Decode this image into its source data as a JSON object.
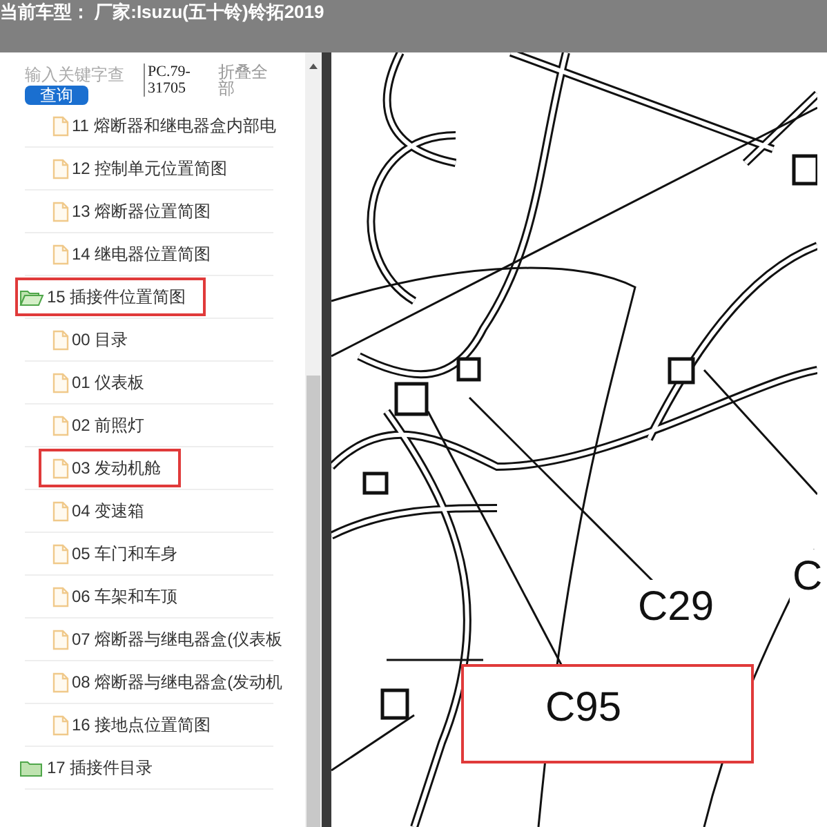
{
  "header": {
    "title": "当前车型： 厂家:Isuzu(五十铃)铃拓2019"
  },
  "search": {
    "placeholder": "输入关键字查",
    "button": "查询",
    "code": "PC.79-31705",
    "collapse": "折叠全部"
  },
  "tree": {
    "continued_children": [
      {
        "label": "11 熔断器和继电器盒内部电",
        "kind": "file",
        "highlighted": false
      },
      {
        "label": "12 控制单元位置简图",
        "kind": "file",
        "highlighted": false
      },
      {
        "label": "13 熔断器位置简图",
        "kind": "file",
        "highlighted": false
      },
      {
        "label": "14 继电器位置简图",
        "kind": "file",
        "highlighted": false
      }
    ],
    "items": [
      {
        "label": "15 插接件位置简图",
        "kind": "folder",
        "expanded": true,
        "highlighted": true,
        "children": [
          {
            "label": "00 目录",
            "kind": "file",
            "highlighted": false
          },
          {
            "label": "01 仪表板",
            "kind": "file",
            "highlighted": false
          },
          {
            "label": "02 前照灯",
            "kind": "file",
            "highlighted": false
          },
          {
            "label": "03 发动机舱",
            "kind": "file",
            "highlighted": true
          },
          {
            "label": "04 变速箱",
            "kind": "file",
            "highlighted": false
          },
          {
            "label": "05 车门和车身",
            "kind": "file",
            "highlighted": false
          },
          {
            "label": "06 车架和车顶",
            "kind": "file",
            "highlighted": false
          },
          {
            "label": "07 熔断器与继电器盒(仪表板",
            "kind": "file",
            "highlighted": false
          },
          {
            "label": "08 熔断器与继电器盒(发动机",
            "kind": "file",
            "highlighted": false
          },
          {
            "label": "16 接地点位置简图",
            "kind": "file",
            "highlighted": false
          }
        ]
      },
      {
        "label": "17 插接件目录",
        "kind": "folder",
        "expanded": false,
        "highlighted": false
      }
    ]
  },
  "diagram": {
    "labels": [
      {
        "text": "C29",
        "highlighted": false
      },
      {
        "text": "C95",
        "highlighted": true
      },
      {
        "text": "C",
        "highlighted": false
      }
    ]
  }
}
